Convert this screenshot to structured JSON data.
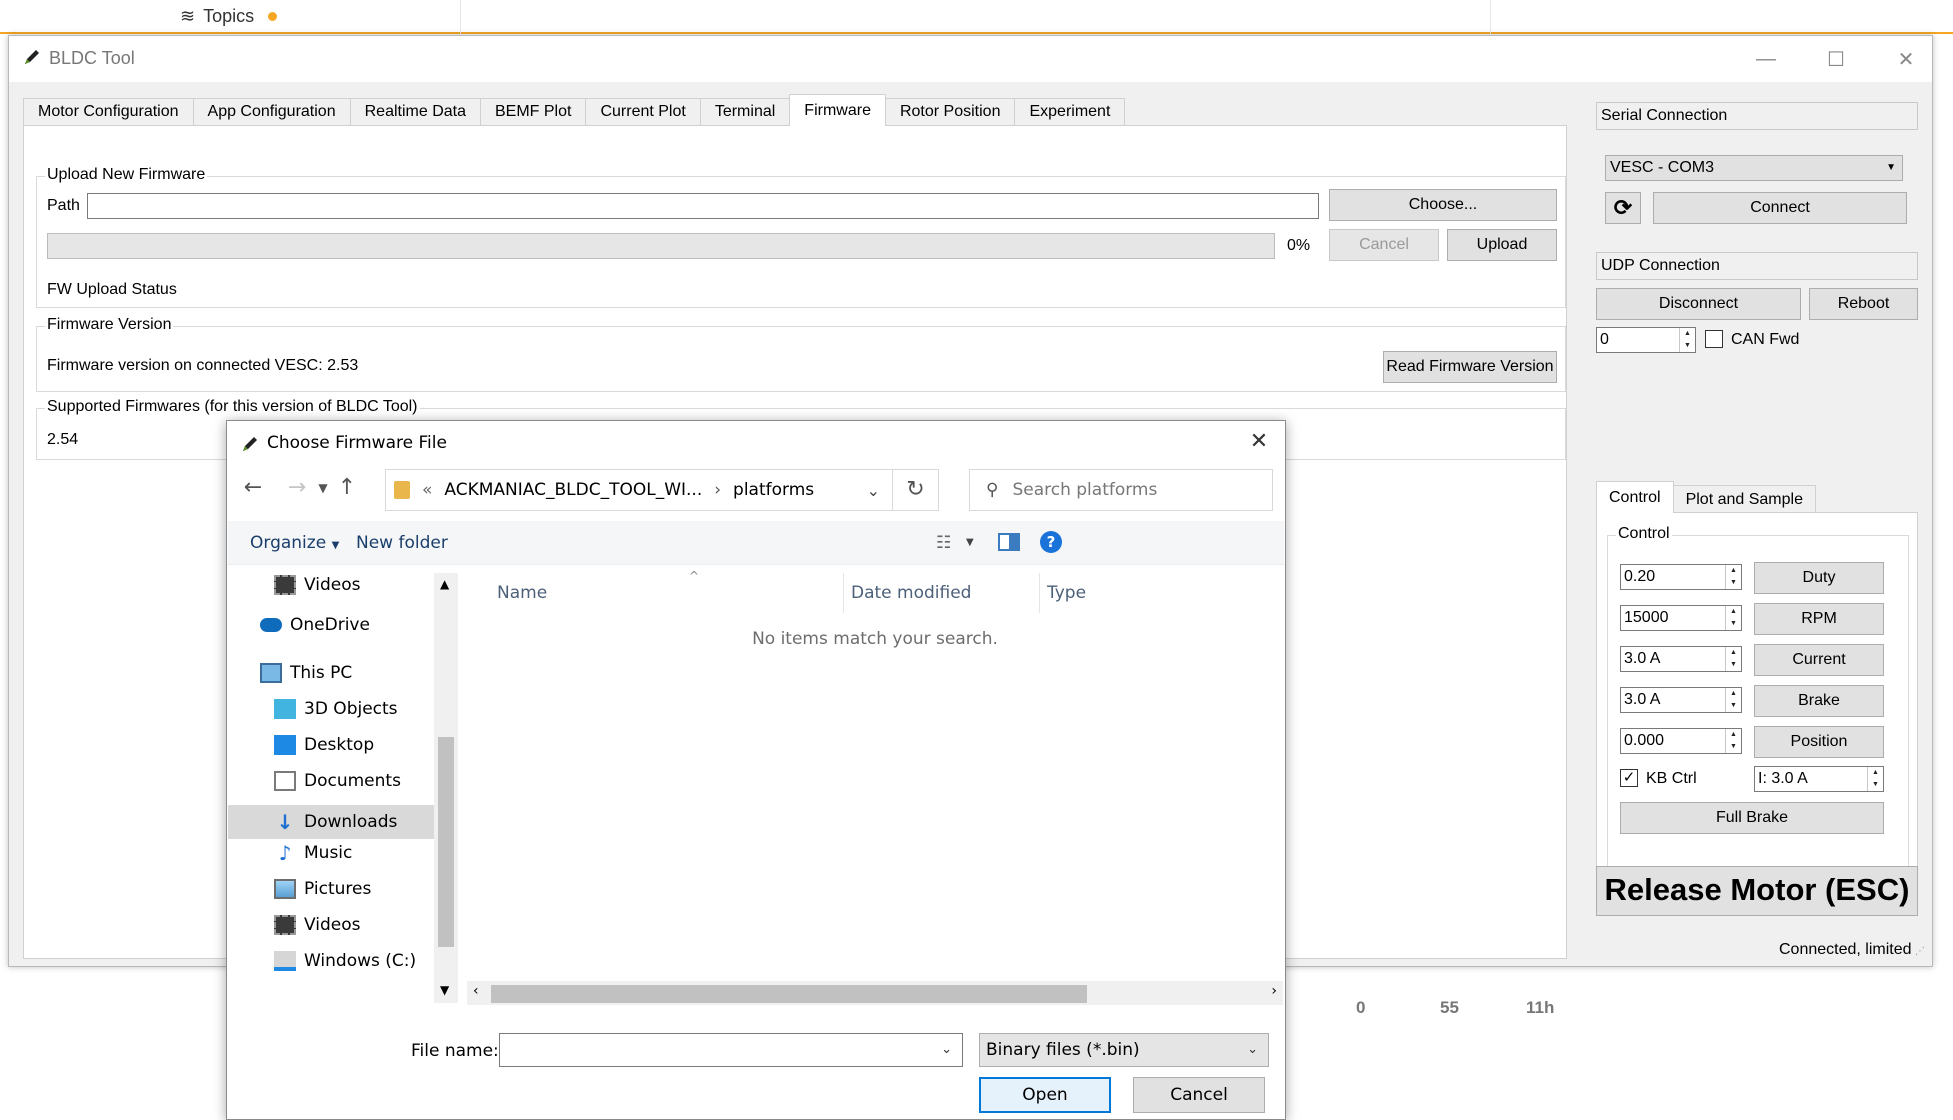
{
  "background": {
    "topics_label": "Topics",
    "stats": [
      "0",
      "55",
      "11h"
    ]
  },
  "window": {
    "title": "BLDC Tool",
    "tabs": [
      "Motor Configuration",
      "App Configuration",
      "Realtime Data",
      "BEMF Plot",
      "Current Plot",
      "Terminal",
      "Firmware",
      "Rotor Position",
      "Experiment"
    ],
    "active_tab": "Firmware"
  },
  "firmware": {
    "upload_group_title": "Upload New Firmware",
    "path_label": "Path",
    "path_value": "",
    "choose_button": "Choose...",
    "progress_percent": 0,
    "progress_text": "0%",
    "cancel_button": "Cancel",
    "upload_button": "Upload",
    "status_text": "FW Upload Status",
    "version_group_title": "Firmware Version",
    "version_text": "Firmware version on connected VESC: 2.53",
    "read_version_button": "Read Firmware Version",
    "supported_group_title": "Supported Firmwares (for this version of BLDC Tool)",
    "supported_list": "2.54"
  },
  "right_panel": {
    "serial_header": "Serial Connection",
    "port_selected": "VESC - COM3",
    "connect_button": "Connect",
    "udp_header": "UDP Connection",
    "disconnect_button": "Disconnect",
    "reboot_button": "Reboot",
    "can_id_value": "0",
    "can_fwd_label": "CAN Fwd",
    "can_fwd_checked": false,
    "subtabs": [
      "Control",
      "Plot and Sample"
    ],
    "active_subtab": "Control",
    "control_group_title": "Control",
    "controls": [
      {
        "value": "0.20",
        "button": "Duty"
      },
      {
        "value": "15000",
        "button": "RPM"
      },
      {
        "value": "3.0 A",
        "button": "Current"
      },
      {
        "value": "3.0 A",
        "button": "Brake"
      },
      {
        "value": "0.000",
        "button": "Position"
      }
    ],
    "kb_ctrl_label": "KB Ctrl",
    "kb_ctrl_checked": true,
    "kb_current_value": "I: 3.0 A",
    "full_brake_button": "Full Brake",
    "release_button": "Release Motor (ESC)"
  },
  "status_bar": {
    "text": "Connected, limited"
  },
  "file_dialog": {
    "title": "Choose Firmware File",
    "breadcrumb_overflow": "«",
    "breadcrumb": [
      "ACKMANIAC_BLDC_TOOL_WI...",
      "platforms"
    ],
    "search_placeholder": "Search platforms",
    "organize_label": "Organize",
    "new_folder_label": "New folder",
    "nav_items": [
      "Videos",
      "OneDrive",
      "This PC",
      "3D Objects",
      "Desktop",
      "Documents",
      "Downloads",
      "Music",
      "Pictures",
      "Videos",
      "Windows (C:)"
    ],
    "selected_nav": "Downloads",
    "columns": [
      "Name",
      "Date modified",
      "Type"
    ],
    "empty_message": "No items match your search.",
    "file_name_label": "File name:",
    "file_name_value": "",
    "file_type_selected": "Binary files (*.bin)",
    "open_button": "Open",
    "cancel_button": "Cancel"
  }
}
